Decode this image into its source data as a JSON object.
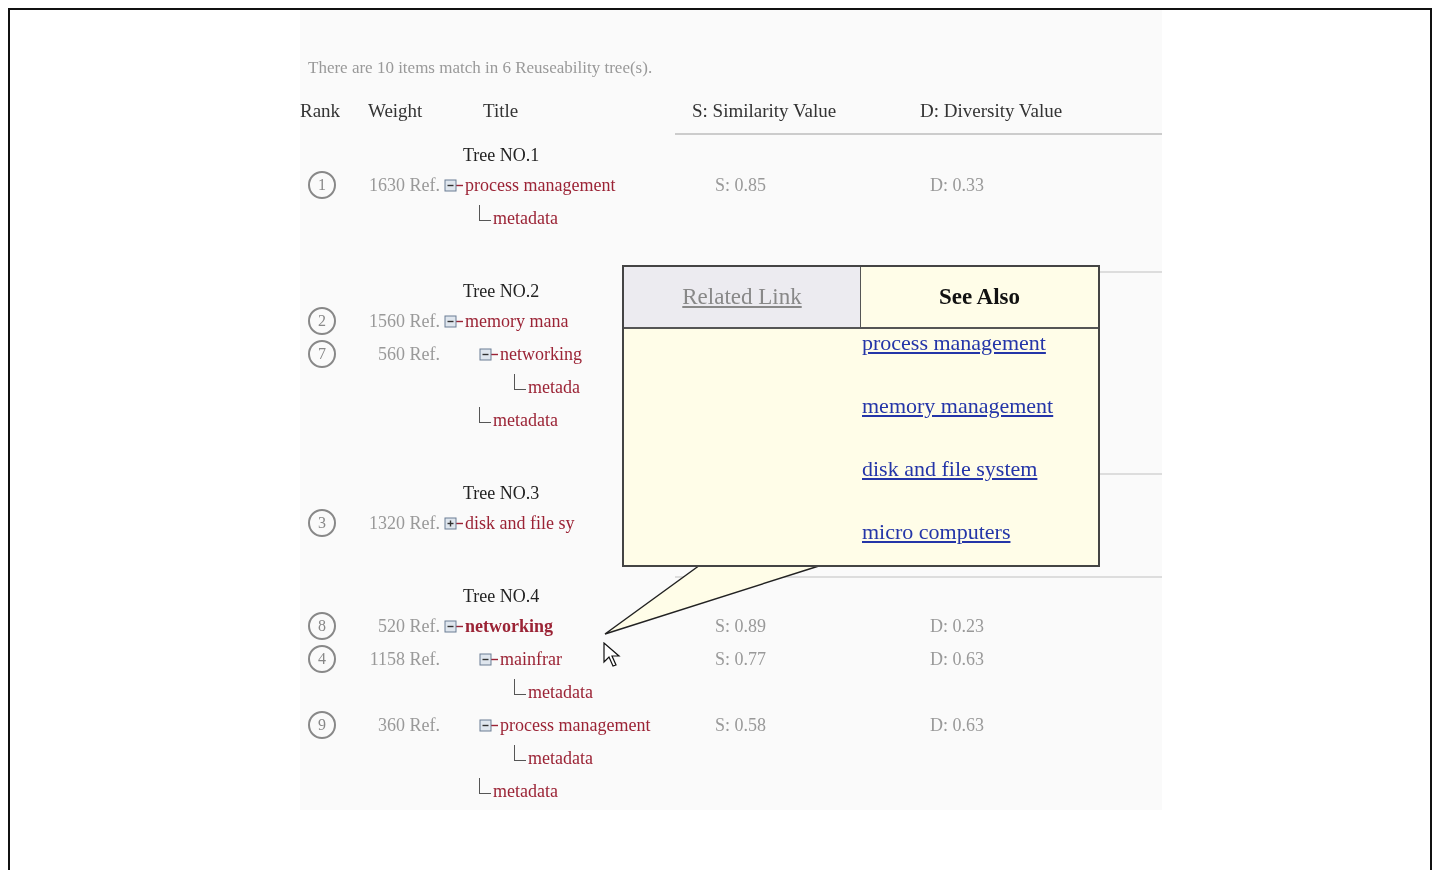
{
  "summary": "There are 10 items match in 6 Reuseability tree(s).",
  "columns": [
    "Rank",
    "Weight",
    "Title",
    "S: Similarity Value",
    "D: Diversity Value"
  ],
  "trees": [
    {
      "title": "Tree NO.1",
      "nodes": [
        {
          "rank": "1",
          "weight": "1630 Ref.",
          "label": "process management",
          "expanded": true,
          "selected": false,
          "s": "S: 0.85",
          "d": "D: 0.33",
          "children": [
            {
              "label": "metadata",
              "selected": false
            }
          ]
        }
      ]
    },
    {
      "title": "Tree NO.2",
      "nodes": [
        {
          "rank": "2",
          "weight": "1560 Ref.",
          "label": "memory mana",
          "expanded": true,
          "selected": false,
          "children": [
            {
              "rank": "7",
              "weight": "560 Ref.",
              "label": "networking",
              "expanded": true,
              "selected": false,
              "children": [
                {
                  "label": "metada",
                  "selected": false
                }
              ]
            },
            {
              "label": "metadata",
              "selected": false
            }
          ]
        }
      ]
    },
    {
      "title": "Tree NO.3",
      "nodes": [
        {
          "rank": "3",
          "weight": "1320 Ref.",
          "label": "disk and file sy",
          "expanded": false,
          "selected": false
        }
      ]
    },
    {
      "title": "Tree NO.4",
      "nodes": [
        {
          "rank": "8",
          "weight": "520 Ref.",
          "label": "networking",
          "expanded": true,
          "selected": true,
          "s": "S: 0.89",
          "d": "D: 0.23",
          "children": [
            {
              "rank": "4",
              "weight": "1158 Ref.",
              "label": "mainfrar",
              "expanded": true,
              "selected": false,
              "s": "S: 0.77",
              "d": "D: 0.63",
              "children": [
                {
                  "label": "metadata",
                  "selected": false
                }
              ]
            },
            {
              "rank": "9",
              "weight": "360 Ref.",
              "label": "process management",
              "expanded": true,
              "selected": false,
              "s": "S: 0.58",
              "d": "D: 0.63",
              "children": [
                {
                  "label": "metadata",
                  "selected": false
                }
              ]
            },
            {
              "label": "metadata",
              "selected": false
            }
          ]
        }
      ]
    }
  ],
  "popup": {
    "tabs": [
      {
        "label": "Related Link",
        "selected": false
      },
      {
        "label": "See Also",
        "selected": true
      }
    ],
    "links": [
      "process management",
      "memory management",
      "disk and file system",
      "micro computers"
    ]
  }
}
